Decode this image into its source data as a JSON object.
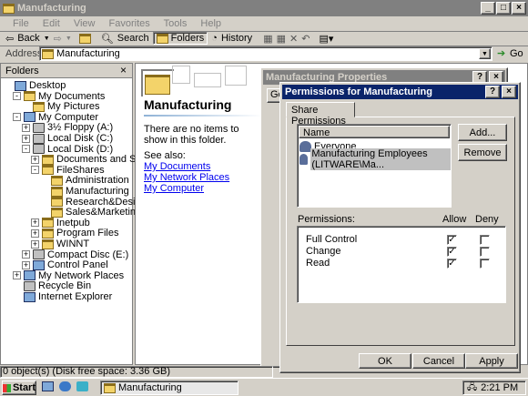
{
  "window": {
    "title": "Manufacturing",
    "controls": [
      "_",
      "□",
      "×"
    ]
  },
  "menu": [
    "File",
    "Edit",
    "View",
    "Favorites",
    "Tools",
    "Help"
  ],
  "toolbar": {
    "back": "Back",
    "search": "Search",
    "folders": "Folders",
    "history": "History"
  },
  "address": {
    "label": "Address",
    "value": "Manufacturing",
    "go": "Go"
  },
  "folders_pane": {
    "title": "Folders",
    "close": "×",
    "items": [
      "Desktop",
      "My Documents",
      "My Pictures",
      "My Computer",
      "3½ Floppy (A:)",
      "Local Disk (C:)",
      "Local Disk (D:)",
      "Documents and Settings",
      "FileShares",
      "Administration",
      "Manufacturing",
      "Research&Design",
      "Sales&Marketing",
      "Inetpub",
      "Program Files",
      "WINNT",
      "Compact Disc (E:)",
      "Control Panel",
      "My Network Places",
      "Recycle Bin",
      "Internet Explorer"
    ]
  },
  "content": {
    "heading": "Manufacturing",
    "empty_text": "There are no items to show in this folder.",
    "see_also": "See also:",
    "links": [
      "My Documents",
      "My Network Places",
      "My Computer"
    ]
  },
  "properties_dialog": {
    "title": "Manufacturing Properties",
    "tab_partial": "Ge"
  },
  "permissions_dialog": {
    "title": "Permissions for Manufacturing",
    "help": "?",
    "close": "×",
    "tab": "Share Permissions",
    "name_header": "Name",
    "names": [
      "Everyone",
      "Manufacturing Employees (LITWARE\\Ma..."
    ],
    "add": "Add...",
    "remove": "Remove",
    "permissions_label": "Permissions:",
    "allow": "Allow",
    "deny": "Deny",
    "permissions": [
      {
        "name": "Full Control",
        "allow": true,
        "deny": false
      },
      {
        "name": "Change",
        "allow": true,
        "deny": false
      },
      {
        "name": "Read",
        "allow": true,
        "deny": false
      }
    ],
    "ok": "OK",
    "cancel": "Cancel",
    "apply": "Apply"
  },
  "status": {
    "text": "0 object(s) (Disk free space: 3.36 GB)"
  },
  "taskbar": {
    "start": "Start",
    "task": "Manufacturing",
    "time": "2:21 PM"
  }
}
